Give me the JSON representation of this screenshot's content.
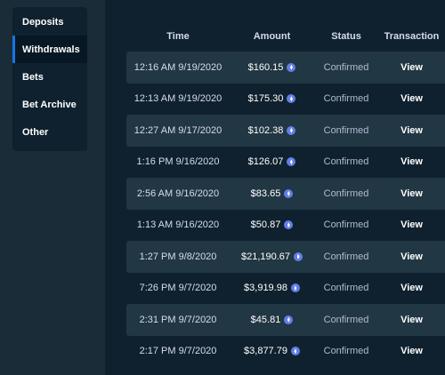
{
  "sidebar": {
    "items": [
      {
        "label": "Deposits",
        "active": false
      },
      {
        "label": "Withdrawals",
        "active": true
      },
      {
        "label": "Bets",
        "active": false
      },
      {
        "label": "Bet Archive",
        "active": false
      },
      {
        "label": "Other",
        "active": false
      }
    ]
  },
  "table": {
    "columns": [
      "Time",
      "Amount",
      "Status",
      "Transaction"
    ],
    "currency_icon": "ethereum-icon",
    "accent_color": "#1475e1",
    "rows": [
      {
        "time": "12:16 AM 9/19/2020",
        "amount": "$160.15",
        "status": "Confirmed",
        "action": "View"
      },
      {
        "time": "12:13 AM 9/19/2020",
        "amount": "$175.30",
        "status": "Confirmed",
        "action": "View"
      },
      {
        "time": "12:27 AM 9/17/2020",
        "amount": "$102.38",
        "status": "Confirmed",
        "action": "View"
      },
      {
        "time": "1:16 PM 9/16/2020",
        "amount": "$126.07",
        "status": "Confirmed",
        "action": "View"
      },
      {
        "time": "2:56 AM 9/16/2020",
        "amount": "$83.65",
        "status": "Confirmed",
        "action": "View"
      },
      {
        "time": "1:13 AM 9/16/2020",
        "amount": "$50.87",
        "status": "Confirmed",
        "action": "View"
      },
      {
        "time": "1:27 PM 9/8/2020",
        "amount": "$21,190.67",
        "status": "Confirmed",
        "action": "View"
      },
      {
        "time": "7:26 PM 9/7/2020",
        "amount": "$3,919.98",
        "status": "Confirmed",
        "action": "View"
      },
      {
        "time": "2:31 PM 9/7/2020",
        "amount": "$45.81",
        "status": "Confirmed",
        "action": "View"
      },
      {
        "time": "2:17 PM 9/7/2020",
        "amount": "$3,877.79",
        "status": "Confirmed",
        "action": "View"
      }
    ]
  }
}
